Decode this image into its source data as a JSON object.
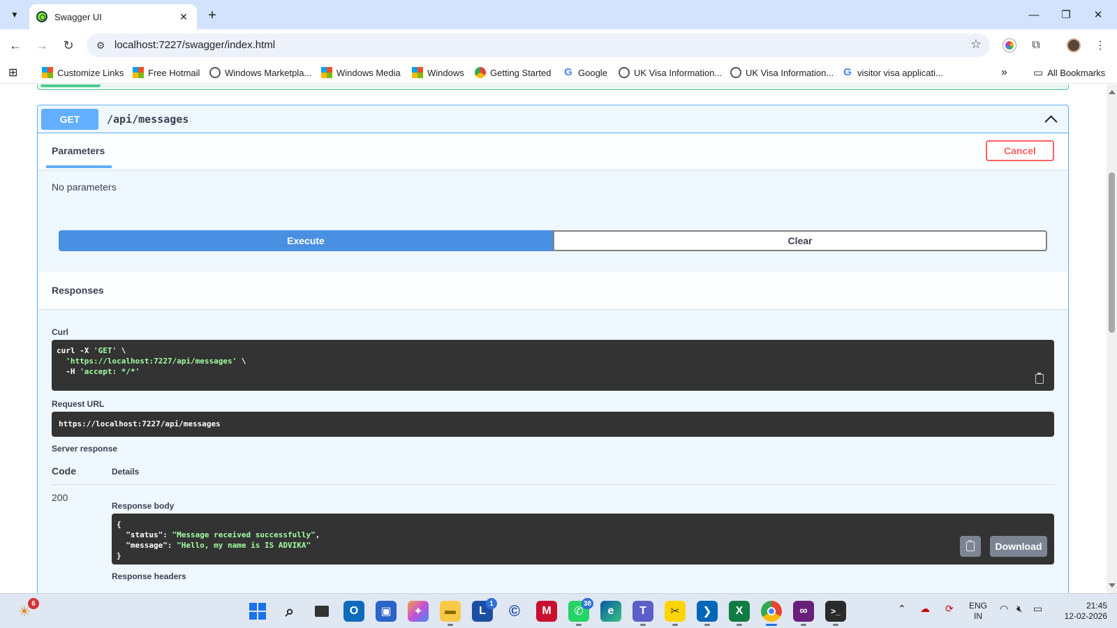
{
  "browser": {
    "tab_title": "Swagger UI",
    "url": "localhost:7227/swagger/index.html",
    "bookmarks": [
      {
        "label": "Customize Links",
        "icon": "ms"
      },
      {
        "label": "Free Hotmail",
        "icon": "ms"
      },
      {
        "label": "Windows Marketpla...",
        "icon": "globe"
      },
      {
        "label": "Windows Media",
        "icon": "ms"
      },
      {
        "label": "Windows",
        "icon": "ms"
      },
      {
        "label": "Getting Started",
        "icon": "chrome"
      },
      {
        "label": "Google",
        "icon": "google"
      },
      {
        "label": "UK Visa Information...",
        "icon": "globe"
      },
      {
        "label": "UK Visa Information...",
        "icon": "globe"
      },
      {
        "label": "visitor visa applicati...",
        "icon": "google"
      }
    ],
    "all_bookmarks": "All Bookmarks",
    "more_bookmarks_glyph": "»"
  },
  "operation": {
    "method": "GET",
    "path": "/api/messages",
    "parameters_tab": "Parameters",
    "cancel_label": "Cancel",
    "no_parameters": "No parameters",
    "execute_label": "Execute",
    "clear_label": "Clear",
    "responses_title": "Responses"
  },
  "result": {
    "curl_label": "Curl",
    "curl_line1": "curl -X ",
    "curl_method": "'GET'",
    "curl_line1_end": " \\",
    "curl_url": "'https://localhost:7227/api/messages'",
    "curl_line2_end": " \\",
    "curl_line3_start": "  -H ",
    "curl_header": "'accept: */*'",
    "request_url_label": "Request URL",
    "request_url": "https://localhost:7227/api/messages",
    "server_response_label": "Server response",
    "code_header": "Code",
    "details_header": "Details",
    "status_code": "200",
    "response_body_label": "Response body",
    "body_open": "{",
    "body_key1": "\"status\"",
    "body_val1": "\"Message received successfully\"",
    "body_key2": "\"message\"",
    "body_val2": "\"Hello, my name is IS ADVIKA\"",
    "body_close": "}",
    "download_label": "Download",
    "response_headers_label": "Response headers"
  },
  "taskbar": {
    "weather_badge": "6",
    "outlook_badge": "1",
    "whatsapp_badge": "38",
    "lang_line1": "ENG",
    "lang_line2": "IN",
    "time": "21:45",
    "date": "12-02-2026"
  },
  "colors": {
    "get": "#61affe",
    "execute": "#4990e2",
    "cancel": "#ff6060",
    "code_bg": "#333333",
    "string": "#a2fca2"
  }
}
